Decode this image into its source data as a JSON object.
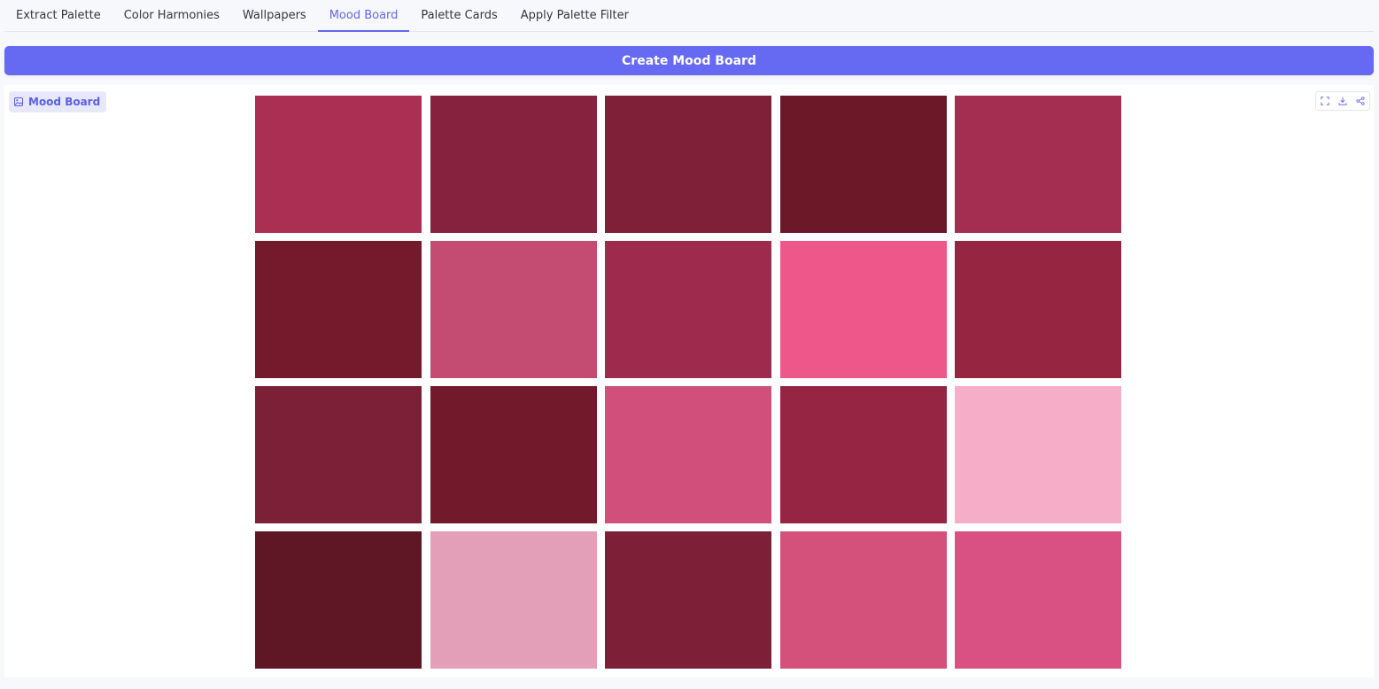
{
  "tabs": [
    {
      "label": "Extract Palette",
      "active": false
    },
    {
      "label": "Color Harmonies",
      "active": false
    },
    {
      "label": "Wallpapers",
      "active": false
    },
    {
      "label": "Mood Board",
      "active": true
    },
    {
      "label": "Palette Cards",
      "active": false
    },
    {
      "label": "Apply Palette Filter",
      "active": false
    }
  ],
  "create_button": {
    "label": "Create Mood Board"
  },
  "panel": {
    "badge_label": "Mood Board",
    "badge_icon": "image-icon",
    "tools": [
      "fullscreen-icon",
      "download-icon",
      "share-icon"
    ]
  },
  "colors": {
    "accent": "#6366f1",
    "button": "#6669f1"
  },
  "swatches": [
    "#aa2f52",
    "#87223e",
    "#801f38",
    "#6c1828",
    "#a42e52",
    "#751a2c",
    "#c44c72",
    "#9e2a4e",
    "#ed5789",
    "#962541",
    "#7c2037",
    "#721a2b",
    "#d1507b",
    "#962443",
    "#f6aec8",
    "#5f1725",
    "#e39fb7",
    "#7c1f37",
    "#d4517c",
    "#d95182"
  ]
}
